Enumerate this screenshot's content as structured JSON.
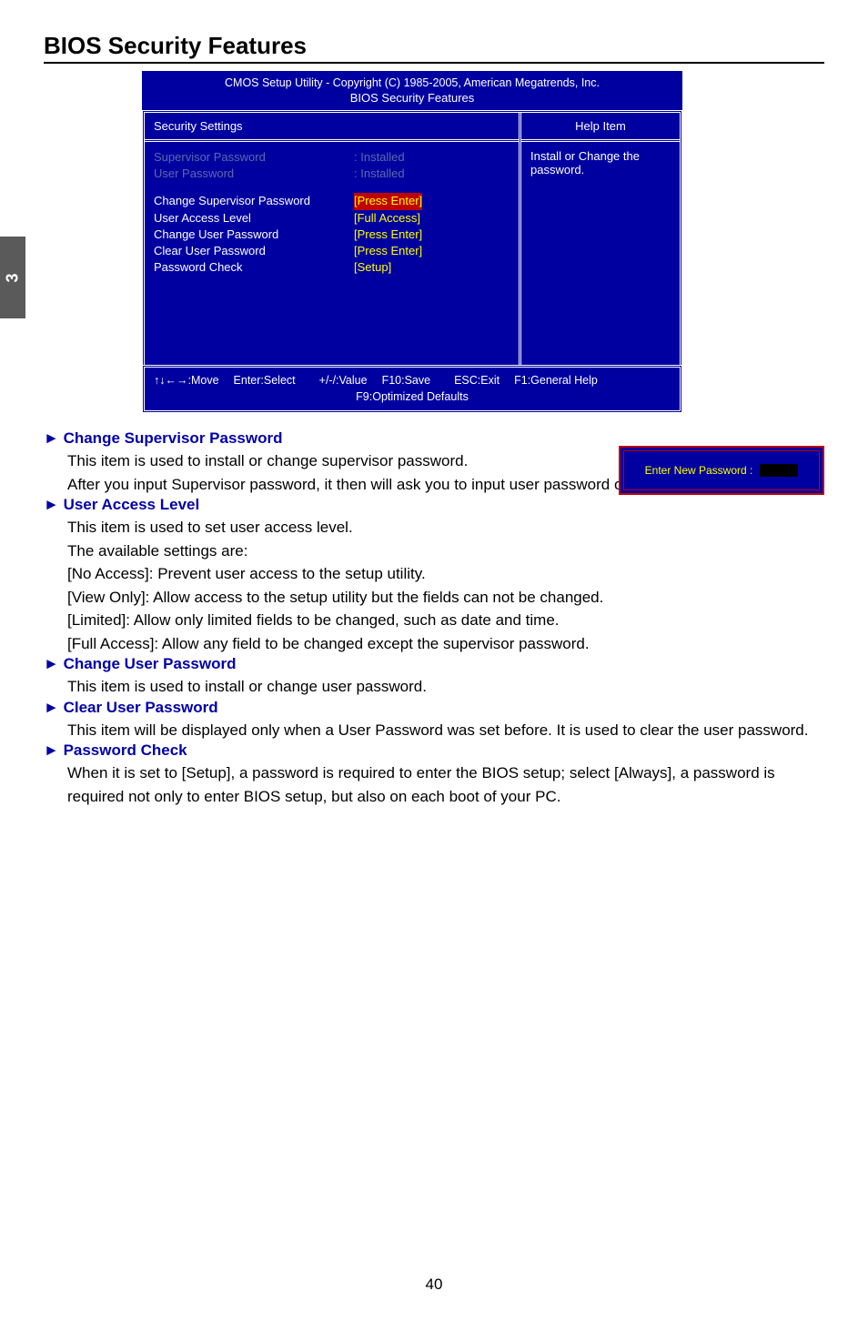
{
  "page_tab": "3",
  "main_heading": "BIOS Security Features",
  "bios": {
    "title": "CMOS Setup Utility - Copyright (C) 1985-2005, American Megatrends, Inc.",
    "subtitle": "BIOS Security Features",
    "left_header": "Security Settings",
    "rows": {
      "supervisor_pw_label": "Supervisor Password",
      "supervisor_pw_value": ": Installed",
      "user_pw_label": "User Password",
      "user_pw_value": ": Installed",
      "change_sup_label": "Change Supervisor Password",
      "change_sup_value": "[Press Enter]",
      "user_access_label": "User Access Level",
      "user_access_value": "[Full Access]",
      "change_user_label": "Change User Password",
      "change_user_value": "[Press Enter]",
      "clear_user_label": "Clear User Password",
      "clear_user_value": "[Press Enter]",
      "pw_check_label": "Password Check",
      "pw_check_value": "[Setup]"
    },
    "right_header": "Help Item",
    "right_body": "Install or Change the password.",
    "footer": {
      "move": "↑↓←→:Move",
      "select": "Enter:Select",
      "value": "+/-/:Value",
      "save": "F10:Save",
      "exit": "ESC:Exit",
      "help": "F1:General Help",
      "defaults": "F9:Optimized Defaults"
    }
  },
  "dialog": {
    "label": "Enter New Password :"
  },
  "sections": [
    {
      "heading": "Change Supervisor Password",
      "body": "This item is used to install or change supervisor password.\nAfter you input Supervisor password, it then will ask you to input user password optionally."
    },
    {
      "heading": "User Access Level",
      "body": "This item is used to set user access level.\nThe available settings are:\n[No Access]: Prevent user access to the setup utility.\n[View Only]: Allow access to the setup utility but the fields can not be changed.\n[Limited]: Allow only limited fields to be changed, such as date and time.\n[Full Access]: Allow any field to be changed except the supervisor password."
    },
    {
      "heading": "Change User Password",
      "body": "This item is used to install or change user password."
    },
    {
      "heading": "Clear User Password",
      "body": "This item will be displayed only when a User Password was set before. It is used to clear the user password."
    },
    {
      "heading": "Password Check",
      "body": "When it is set to [Setup], a password is required to enter the BIOS setup; select [Always], a password is required not only to enter BIOS setup, but also on each boot of your PC."
    }
  ],
  "page_number": "40"
}
